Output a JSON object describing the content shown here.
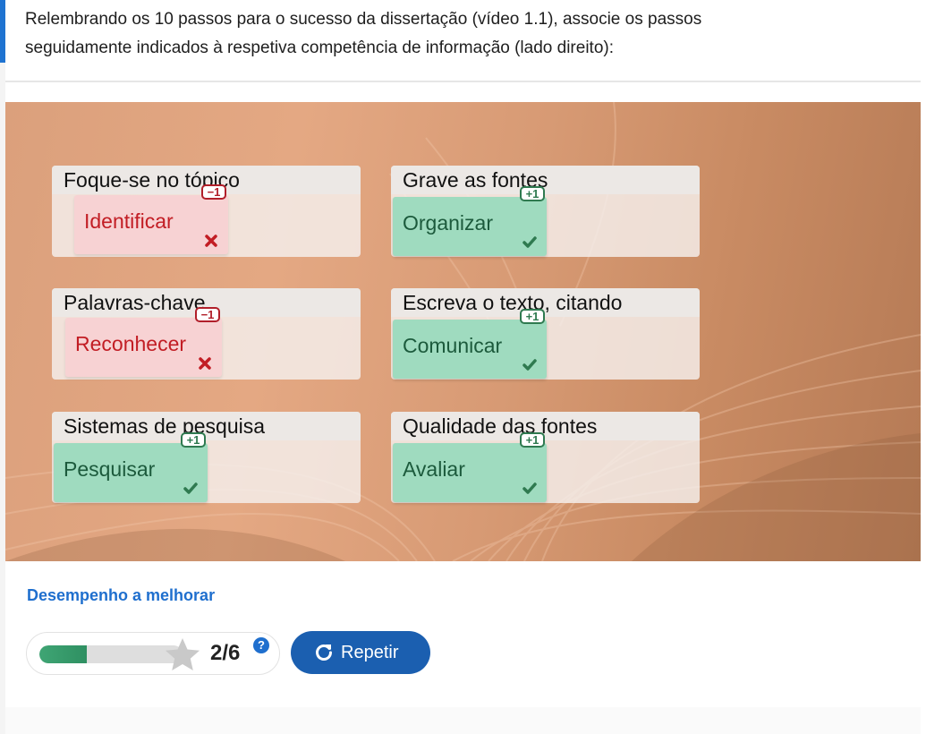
{
  "question": {
    "line1": "Relembrando os 10 passos para o sucesso da dissertação (vídeo 1.1), associe os passos",
    "line2": "seguidamente indicados à respetiva competência de informação (lado direito):"
  },
  "zones": [
    {
      "label": "Foque-se no tópico",
      "answer": "Identificar",
      "status": "wrong",
      "badge": "−1"
    },
    {
      "label": "Grave as fontes",
      "answer": "Organizar",
      "status": "correct",
      "badge": "+1"
    },
    {
      "label": "Palavras-chave",
      "answer": "Reconhecer",
      "status": "wrong",
      "badge": "−1"
    },
    {
      "label": "Escreva o texto, citando",
      "answer": "Comunicar",
      "status": "correct",
      "badge": "+1"
    },
    {
      "label": "Sistemas de pesquisa",
      "answer": "Pesquisar",
      "status": "correct",
      "badge": "+1"
    },
    {
      "label": "Qualidade das fontes",
      "answer": "Avaliar",
      "status": "correct",
      "badge": "+1"
    }
  ],
  "feedback": "Desempenho a melhorar",
  "score": {
    "text": "2/6",
    "help": "?",
    "fraction": 0.333
  },
  "retry_label": "Repetir",
  "colors": {
    "accent": "#1f6fce",
    "correct": "#9fdbbf",
    "wrong": "#f7d2d3",
    "button": "#1b5fb0"
  }
}
